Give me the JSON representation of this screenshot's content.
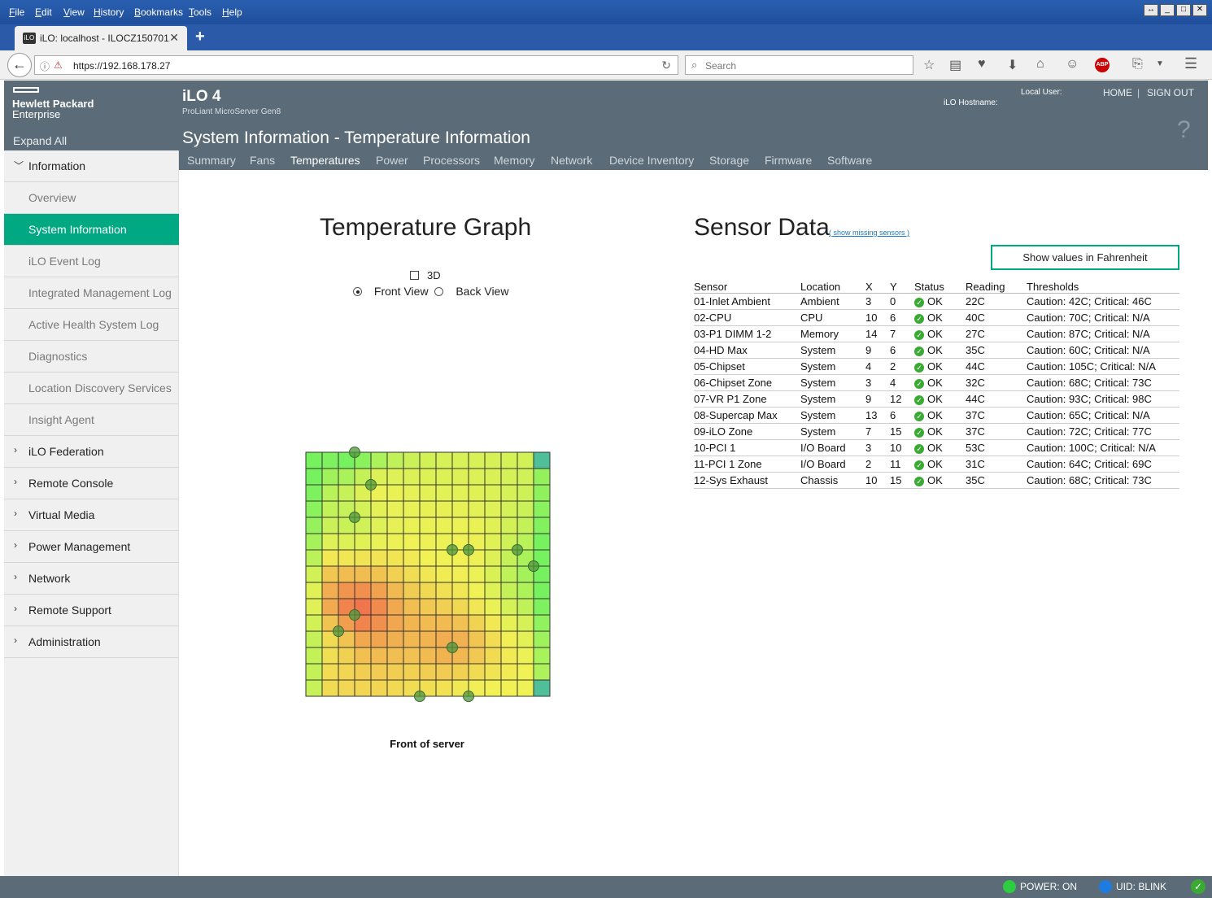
{
  "browser": {
    "menu": [
      "File",
      "Edit",
      "View",
      "History",
      "Bookmarks",
      "Tools",
      "Help"
    ],
    "tab_title": "iLO: localhost - ILOCZ150701...",
    "favicon_text": "iLO",
    "url": "https://192.168.178.27",
    "search_placeholder": "Search"
  },
  "header": {
    "brand_line1": "Hewlett Packard",
    "brand_line2": "Enterprise",
    "product": "iLO 4",
    "server_model": "ProLiant MicroServer Gen8",
    "local_user_label": "Local User:",
    "hostname_label": "iLO Hostname:",
    "home": "HOME",
    "separator": "|",
    "sign_out": "SIGN OUT",
    "expand_all": "Expand All",
    "page_title": "System Information - Temperature Information",
    "help": "?",
    "tabs": [
      "Summary",
      "Fans",
      "Temperatures",
      "Power",
      "Processors",
      "Memory",
      "Network",
      "Device Inventory",
      "Storage",
      "Firmware",
      "Software"
    ],
    "active_tab": "Temperatures"
  },
  "sidebar": {
    "items": [
      {
        "label": "Information",
        "type": "group",
        "expanded": true
      },
      {
        "label": "Overview",
        "type": "sub"
      },
      {
        "label": "System Information",
        "type": "sub",
        "active": true
      },
      {
        "label": "iLO Event Log",
        "type": "sub"
      },
      {
        "label": "Integrated Management Log",
        "type": "sub"
      },
      {
        "label": "Active Health System Log",
        "type": "sub"
      },
      {
        "label": "Diagnostics",
        "type": "sub"
      },
      {
        "label": "Location Discovery Services",
        "type": "sub"
      },
      {
        "label": "Insight Agent",
        "type": "sub"
      },
      {
        "label": "iLO Federation",
        "type": "group"
      },
      {
        "label": "Remote Console",
        "type": "group"
      },
      {
        "label": "Virtual Media",
        "type": "group"
      },
      {
        "label": "Power Management",
        "type": "group"
      },
      {
        "label": "Network",
        "type": "group"
      },
      {
        "label": "Remote Support",
        "type": "group"
      },
      {
        "label": "Administration",
        "type": "group"
      }
    ]
  },
  "graph": {
    "title": "Temperature Graph",
    "option_3d": "3D",
    "front_view": "Front View",
    "back_view": "Back View",
    "caption": "Front of server",
    "grid_cols": 15,
    "grid_rows": 15
  },
  "sensor_data": {
    "title": "Sensor Data",
    "missing_link": "( show missing sensors )",
    "fahrenheit_button": "Show values in Fahrenheit",
    "columns": [
      "Sensor",
      "Location",
      "X",
      "Y",
      "Status",
      "Reading",
      "Thresholds"
    ],
    "rows": [
      [
        "01-Inlet Ambient",
        "Ambient",
        "3",
        "0",
        "OK",
        "22C",
        "Caution: 42C; Critical: 46C"
      ],
      [
        "02-CPU",
        "CPU",
        "10",
        "6",
        "OK",
        "40C",
        "Caution: 70C; Critical: N/A"
      ],
      [
        "03-P1 DIMM 1-2",
        "Memory",
        "14",
        "7",
        "OK",
        "27C",
        "Caution: 87C; Critical: N/A"
      ],
      [
        "04-HD Max",
        "System",
        "9",
        "6",
        "OK",
        "35C",
        "Caution: 60C; Critical: N/A"
      ],
      [
        "05-Chipset",
        "System",
        "4",
        "2",
        "OK",
        "44C",
        "Caution: 105C; Critical: N/A"
      ],
      [
        "06-Chipset Zone",
        "System",
        "3",
        "4",
        "OK",
        "32C",
        "Caution: 68C; Critical: 73C"
      ],
      [
        "07-VR P1 Zone",
        "System",
        "9",
        "12",
        "OK",
        "44C",
        "Caution: 93C; Critical: 98C"
      ],
      [
        "08-Supercap Max",
        "System",
        "13",
        "6",
        "OK",
        "37C",
        "Caution: 65C; Critical: N/A"
      ],
      [
        "09-iLO Zone",
        "System",
        "7",
        "15",
        "OK",
        "37C",
        "Caution: 72C; Critical: 77C"
      ],
      [
        "10-PCI 1",
        "I/O Board",
        "3",
        "10",
        "OK",
        "53C",
        "Caution: 100C; Critical: N/A"
      ],
      [
        "11-PCI 1 Zone",
        "I/O Board",
        "2",
        "11",
        "OK",
        "31C",
        "Caution: 64C; Critical: 69C"
      ],
      [
        "12-Sys Exhaust",
        "Chassis",
        "10",
        "15",
        "OK",
        "35C",
        "Caution: 68C; Critical: 73C"
      ]
    ]
  },
  "statusbar": {
    "power": "POWER: ON",
    "uid": "UID: BLINK",
    "power_led_color": "#2ecc40",
    "uid_led_color": "#1e7be0"
  },
  "colors": {
    "accent": "#01a982",
    "header_bg": "#5b6c78",
    "ok": "#3aaa35"
  }
}
